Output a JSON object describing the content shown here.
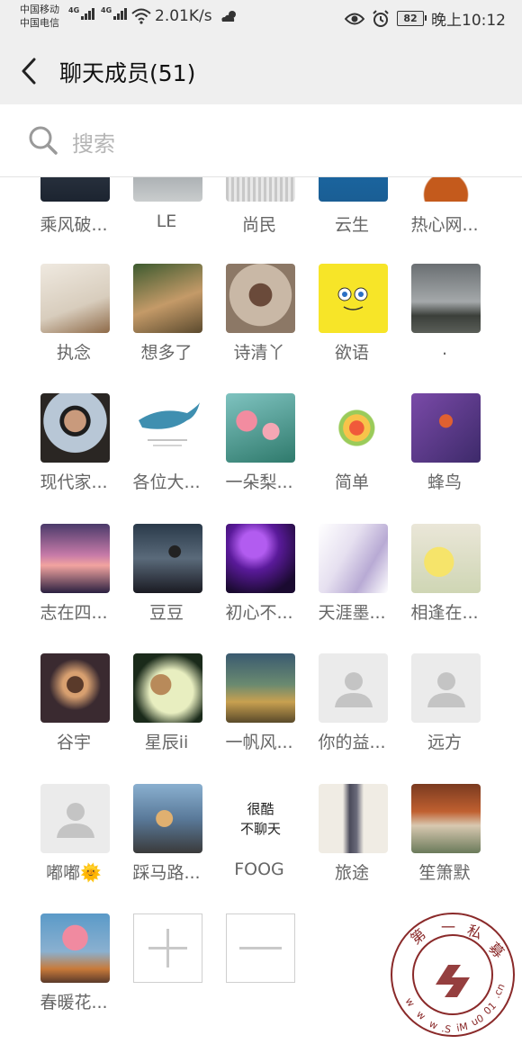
{
  "status": {
    "carrier1": "中国移动",
    "carrier2": "中国电信",
    "net_tag": "4G",
    "speed": "2.01K/s",
    "battery": "82",
    "time": "晚上10:12"
  },
  "header": {
    "title": "聊天成员(51)"
  },
  "search": {
    "placeholder": "搜索"
  },
  "partial_row": [
    "乘风破...",
    "LE",
    "尚民",
    "云生",
    "热心网..."
  ],
  "rows": [
    [
      "执念",
      "想多了",
      "诗清丫",
      "欲语",
      "."
    ],
    [
      "现代家...",
      "各位大...",
      "一朵梨...",
      "简单",
      "蜂鸟"
    ],
    [
      "志在四...",
      "豆豆",
      "初心不...",
      "天涯墨...",
      "相逢在..."
    ],
    [
      "谷宇",
      "星辰ii",
      "一帆风...",
      "你的益...",
      "远方"
    ],
    [
      "嘟嘟🌞",
      "踩马路...",
      "FOOG",
      "旅途",
      "笙箫默"
    ],
    [
      "春暖花..."
    ]
  ],
  "foog_tile": {
    "line1": "很酷",
    "line2": "不聊天"
  },
  "actions": {
    "add": "add-member",
    "remove": "remove-member"
  },
  "watermark": {
    "top": "第一私募",
    "bottom": "www.SiMu001.cn"
  }
}
